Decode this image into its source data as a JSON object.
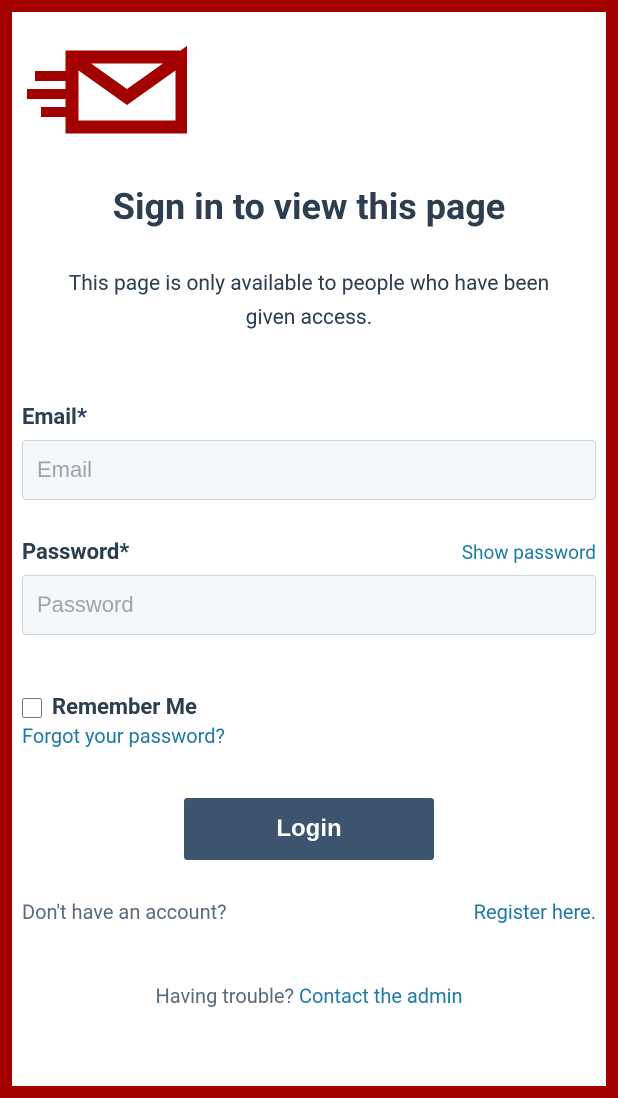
{
  "heading": "Sign in to view this page",
  "subtext": "This page is only available to people who have been given access.",
  "form": {
    "email_label": "Email*",
    "email_placeholder": "Email",
    "password_label": "Password*",
    "password_placeholder": "Password",
    "show_password": "Show password",
    "remember_label": "Remember Me",
    "forgot_link": "Forgot your password?",
    "login_button": "Login"
  },
  "register": {
    "question": "Don't have an account?",
    "link": "Register here."
  },
  "trouble": {
    "question": "Having trouble? ",
    "link": "Contact the admin"
  }
}
